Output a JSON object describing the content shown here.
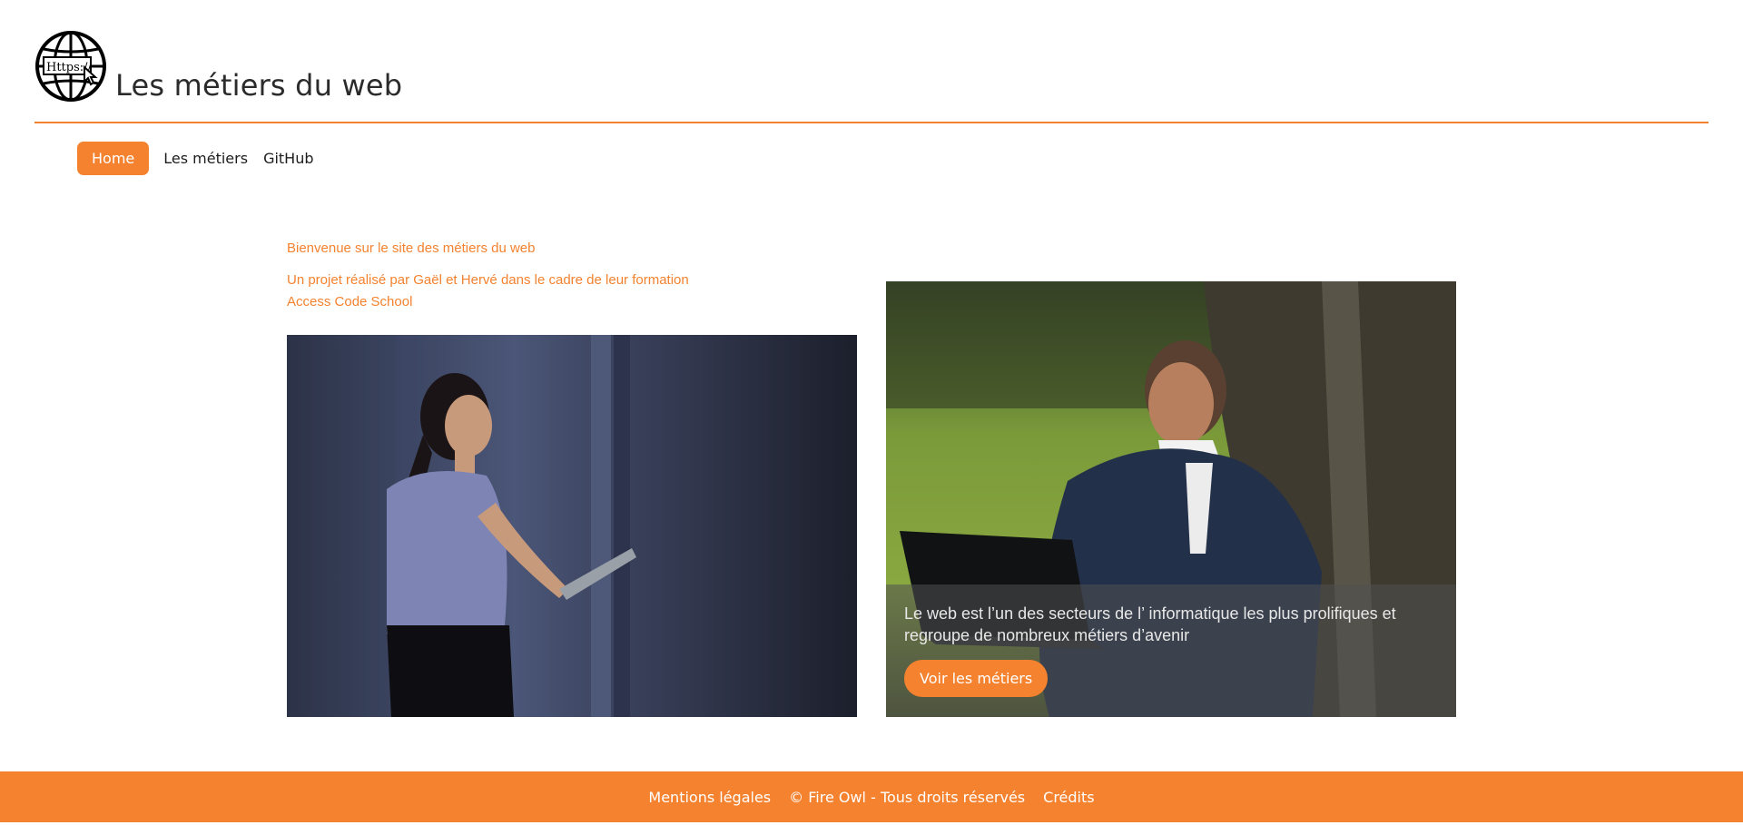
{
  "header": {
    "logo_icon": "globe-https-icon",
    "logo_text": "Https://",
    "title": "Les métiers du web"
  },
  "nav": {
    "items": [
      {
        "label": "Home",
        "active": true
      },
      {
        "label": "Les métiers",
        "active": false
      },
      {
        "label": "GitHub",
        "active": false
      }
    ]
  },
  "intro": {
    "welcome": "Bienvenue sur le site des métiers du web",
    "project_line1": "Un projet réalisé par Gaël et Hervé dans le cadre de leur formation",
    "project_line2": "Access Code School"
  },
  "cards": {
    "right": {
      "caption": "Le web est l’un des secteurs de l’ informatique les plus prolifiques et regroupe de nombreux métiers d’avenir",
      "button_label": "Voir les métiers"
    }
  },
  "footer": {
    "links": [
      "Mentions légales",
      "© Fire Owl - Tous droits réservés",
      "Crédits"
    ]
  },
  "colors": {
    "accent": "#f4822f",
    "text": "#222222",
    "footer_text": "#ffffff"
  }
}
